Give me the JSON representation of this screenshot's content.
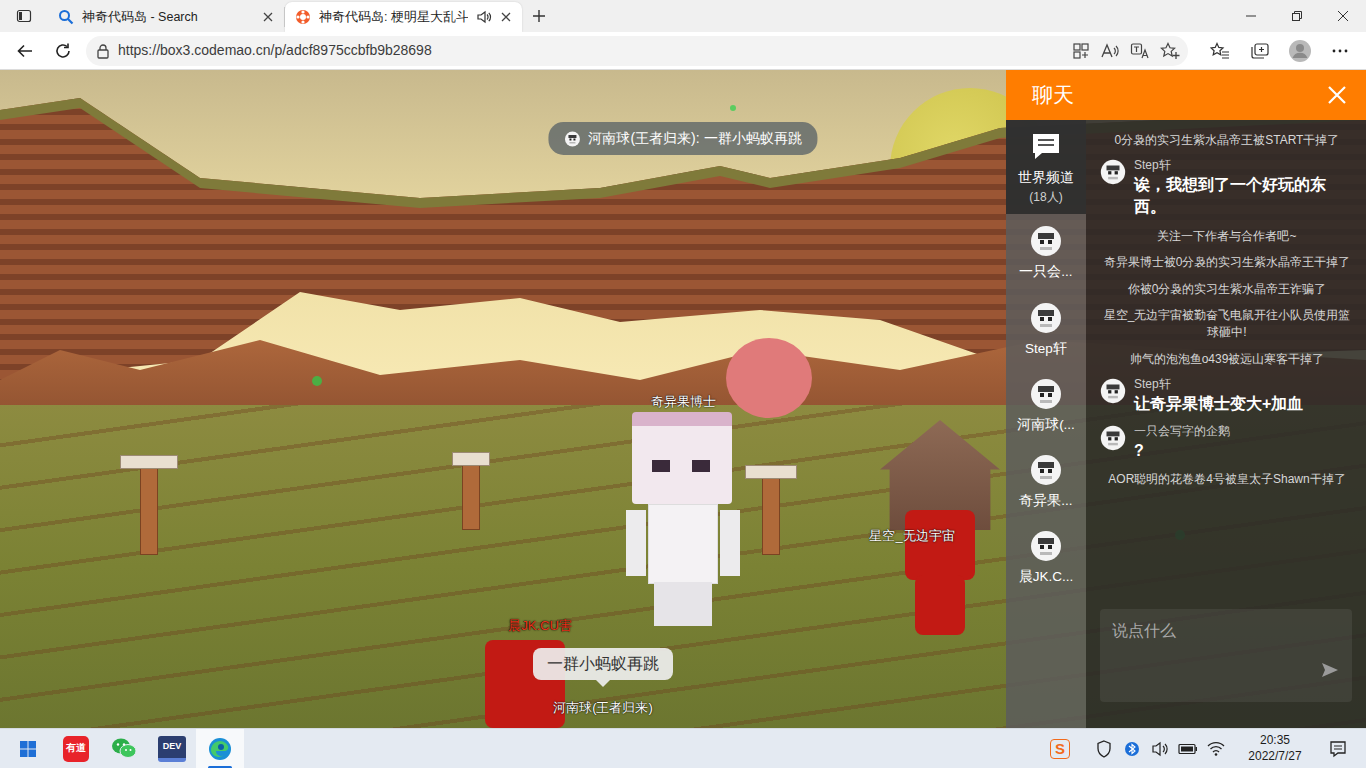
{
  "browser": {
    "tabs": [
      {
        "label": "神奇代码岛 - Search",
        "selected": false,
        "kind": "search-page",
        "audio": false
      },
      {
        "label": "神奇代码岛: 梗明星大乱斗",
        "selected": true,
        "kind": "site-page",
        "audio": true
      }
    ],
    "url": "https://box3.codemao.cn/p/adcf8975ccbfb9b28698"
  },
  "game": {
    "announcement": "河南球(王者归来): 一群小蚂蚁再跳",
    "players": [
      {
        "name": "奇异果博士",
        "color": "#ffffff"
      },
      {
        "name": "星空_无边宇宙",
        "color": "#ffffff"
      },
      {
        "name": "晨JK.CU害",
        "color": "#e8341c"
      },
      {
        "name": "河南球(王者归来)",
        "color": "#ffffff",
        "bubble": "一群小蚂蚁再跳"
      }
    ]
  },
  "chat": {
    "title": "聊天",
    "channels": [
      {
        "label": "世界频道",
        "count": "(18人)",
        "selected": true,
        "kind": "channel"
      },
      {
        "label": "一只会...",
        "selected": false,
        "kind": "user"
      },
      {
        "label": "Step轩",
        "selected": false,
        "kind": "user"
      },
      {
        "label": "河南球(...",
        "selected": false,
        "kind": "user"
      },
      {
        "label": "奇异果...",
        "selected": false,
        "kind": "user"
      },
      {
        "label": "晨JK.C...",
        "selected": false,
        "kind": "user"
      }
    ],
    "messages": [
      {
        "kind": "system",
        "text": "0分袅的实习生紫水晶帝王被START干掉了"
      },
      {
        "kind": "user",
        "name": "Step轩",
        "text": "诶，我想到了一个好玩的东西。"
      },
      {
        "kind": "system",
        "text": "关注一下作者与合作者吧~"
      },
      {
        "kind": "system",
        "text": "奇异果博士被0分袅的实习生紫水晶帝王干掉了"
      },
      {
        "kind": "system",
        "text": "你被0分袅的实习生紫水晶帝王诈骗了"
      },
      {
        "kind": "system",
        "text": "星空_无边宇宙被勤奋飞电鼠开往小队员使用篮球砸中!"
      },
      {
        "kind": "system",
        "text": "帅气的泡泡鱼o439被远山寒客干掉了"
      },
      {
        "kind": "user",
        "name": "Step轩",
        "text": "让奇异果博士变大+加血"
      },
      {
        "kind": "user",
        "name": "一只会写字的企鹅",
        "text": "?"
      },
      {
        "kind": "system",
        "text": "AOR聪明的花卷卷4号被皇太子Shawn干掉了"
      }
    ],
    "input": {
      "placeholder": "说点什么"
    }
  },
  "taskbar": {
    "apps": [
      {
        "kind": "youdao",
        "label": "有道",
        "active": false
      },
      {
        "kind": "wechat",
        "active": false
      },
      {
        "kind": "devtools",
        "label": "DEV",
        "active": false
      },
      {
        "kind": "edge",
        "active": true
      }
    ],
    "ime_label": "S",
    "time": "20:35",
    "date": "2022/7/27"
  }
}
